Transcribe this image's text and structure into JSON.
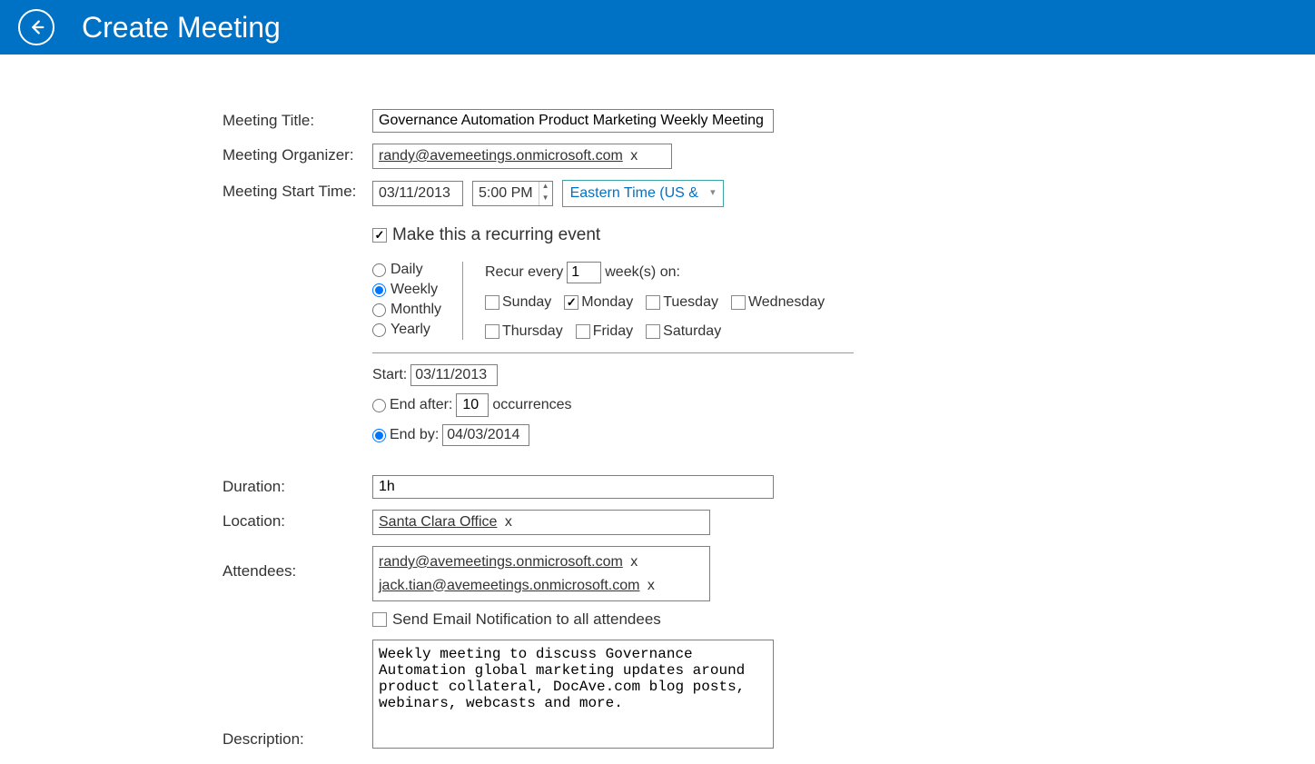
{
  "header": {
    "title": "Create Meeting"
  },
  "labels": {
    "meeting_title": "Meeting Title:",
    "organizer": "Meeting Organizer:",
    "start_time": "Meeting Start Time:",
    "duration": "Duration:",
    "location": "Location:",
    "attendees": "Attendees:",
    "description": "Description:"
  },
  "values": {
    "title": "Governance Automation Product Marketing Weekly Meeting",
    "organizer": "randy@avemeetings.onmicrosoft.com",
    "tag_remove": "x",
    "date": "03/11/2013",
    "time": "5:00 PM",
    "timezone": "Eastern Time (US &",
    "recurring_label": "Make this a recurring event",
    "duration": "1h",
    "location": "Santa Clara Office",
    "attendee1": "randy@avemeetings.onmicrosoft.com",
    "attendee2": "jack.tian@avemeetings.onmicrosoft.com",
    "notify_label": "Send Email Notification to all attendees",
    "description": "Weekly meeting to discuss Governance Automation global marketing updates around product collateral, DocAve.com blog posts, webinars, webcasts and more."
  },
  "freq": {
    "daily": "Daily",
    "weekly": "Weekly",
    "monthly": "Monthly",
    "yearly": "Yearly"
  },
  "pattern": {
    "recur_pre": "Recur every",
    "interval": "1",
    "recur_post": "week(s) on:",
    "sunday": "Sunday",
    "monday": "Monday",
    "tuesday": "Tuesday",
    "wednesday": "Wednesday",
    "thursday": "Thursday",
    "friday": "Friday",
    "saturday": "Saturday"
  },
  "range": {
    "start_label": "Start:",
    "start_date": "03/11/2013",
    "end_after_label": "End after:",
    "occurrences": "10",
    "occ_label": "occurrences",
    "end_by_label": "End by:",
    "end_by_date": "04/03/2014"
  }
}
